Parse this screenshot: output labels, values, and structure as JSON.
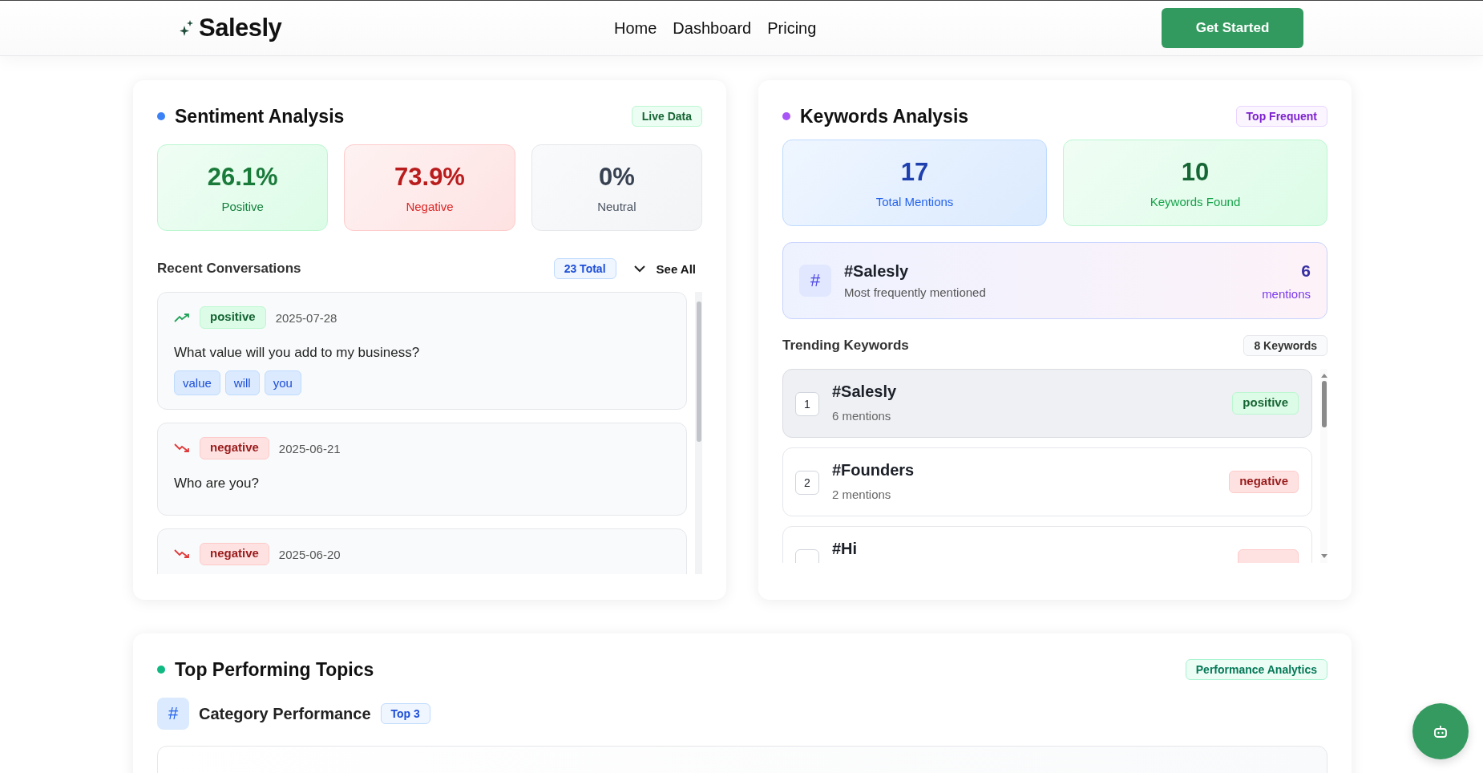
{
  "header": {
    "logo": "Salesly",
    "nav": [
      {
        "label": "Home"
      },
      {
        "label": "Dashboard"
      },
      {
        "label": "Pricing"
      }
    ],
    "cta": "Get Started"
  },
  "sentiment": {
    "title": "Sentiment Analysis",
    "badge": "Live Data",
    "stats": [
      {
        "value": "26.1%",
        "label": "Positive",
        "kind": "positive"
      },
      {
        "value": "73.9%",
        "label": "Negative",
        "kind": "negative"
      },
      {
        "value": "0%",
        "label": "Neutral",
        "kind": "neutral"
      }
    ],
    "recent": {
      "title": "Recent Conversations",
      "count": "23 Total",
      "see_all": "See All",
      "items": [
        {
          "kind": "positive",
          "label": "positive",
          "date": "2025-07-28",
          "text": "What value will you add to my business?",
          "keywords": [
            "value",
            "will",
            "you"
          ]
        },
        {
          "kind": "negative",
          "label": "negative",
          "date": "2025-06-21",
          "text": "Who are you?"
        },
        {
          "kind": "negative",
          "label": "negative",
          "date": "2025-06-20"
        }
      ]
    }
  },
  "keywords": {
    "title": "Keywords Analysis",
    "badge": "Top Frequent",
    "stats": [
      {
        "value": "17",
        "label": "Total Mentions",
        "kind": "blue"
      },
      {
        "value": "10",
        "label": "Keywords Found",
        "kind": "green"
      }
    ],
    "top": {
      "icon": "#",
      "name": "#Salesly",
      "caption": "Most frequently mentioned",
      "count": "6",
      "unit": "mentions"
    },
    "trending": {
      "title": "Trending Keywords",
      "count": "8 Keywords",
      "items": [
        {
          "rank": "1",
          "name": "#Salesly",
          "mentions": "6 mentions",
          "kind": "positive",
          "label": "positive",
          "selected": true
        },
        {
          "rank": "2",
          "name": "#Founders",
          "mentions": "2 mentions",
          "kind": "negative",
          "label": "negative",
          "selected": false
        },
        {
          "name": "#Hi",
          "kind": "negative",
          "selected": false
        }
      ]
    }
  },
  "topics": {
    "title": "Top Performing Topics",
    "badge": "Performance Analytics",
    "category": {
      "icon": "#",
      "title": "Category Performance",
      "badge": "Top 3"
    }
  }
}
